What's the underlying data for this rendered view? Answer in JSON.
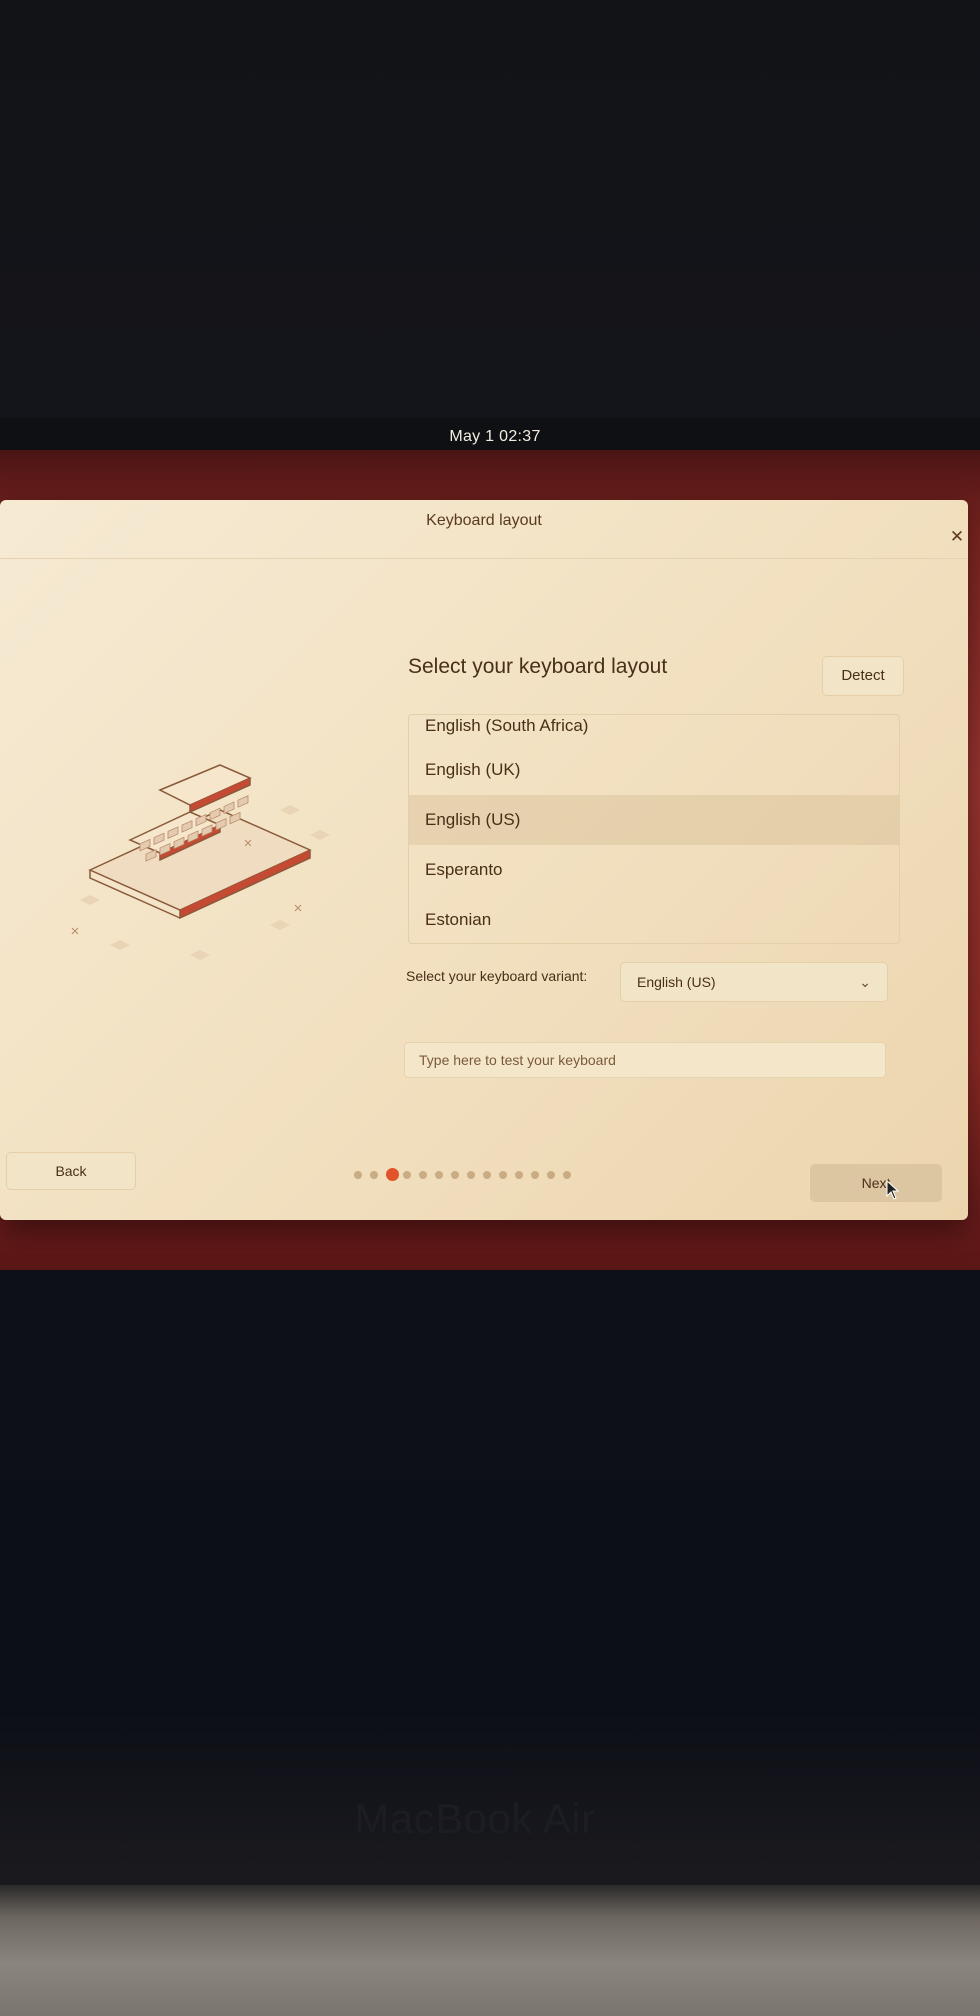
{
  "topbar": {
    "clock": "May 1  02:37"
  },
  "window": {
    "title": "Keyboard layout",
    "close_icon": "close-icon"
  },
  "main": {
    "heading": "Select your keyboard layout",
    "detect_label": "Detect",
    "layouts": [
      {
        "label": "English (South Africa)",
        "selected": false
      },
      {
        "label": "English (UK)",
        "selected": false
      },
      {
        "label": "English (US)",
        "selected": true
      },
      {
        "label": "Esperanto",
        "selected": false
      },
      {
        "label": "Estonian",
        "selected": false
      }
    ],
    "variant_label": "Select your keyboard variant:",
    "variant_value": "English (US)",
    "test_placeholder": "Type here to test your keyboard"
  },
  "footer": {
    "back_label": "Back",
    "next_label": "Next",
    "steps_total": 14,
    "steps_current": 3
  },
  "device": {
    "brand": "MacBook Air"
  },
  "colors": {
    "accent": "#e0532b",
    "window_bg": "#f3e3c5",
    "text": "#4a2f18",
    "screen_bg": "#9a3530"
  }
}
